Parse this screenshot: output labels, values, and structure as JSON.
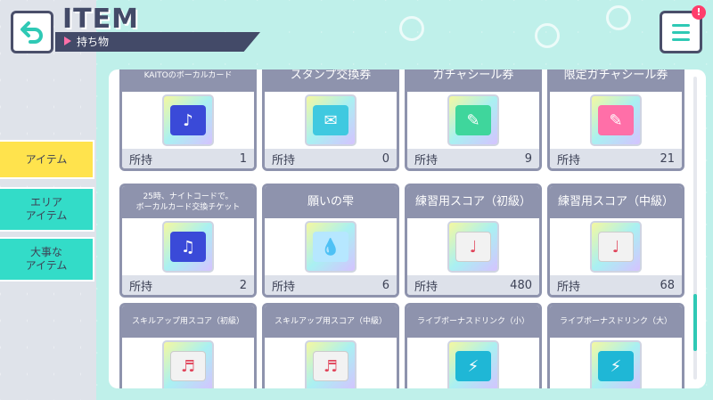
{
  "header": {
    "title": "ITEM",
    "subtitle": "持ち物",
    "notification_badge": "!"
  },
  "sidebar": {
    "tabs": [
      {
        "label": "アイテム",
        "active": true
      },
      {
        "label": "エリア\nアイテム",
        "active": false
      },
      {
        "label": "大事な\nアイテム",
        "active": false
      }
    ]
  },
  "items": [
    {
      "name": "KAITOのボーカルカード",
      "owned_label": "所持",
      "count": "1",
      "icon": "music-card-icon"
    },
    {
      "name": "スタンプ交換券",
      "owned_label": "所持",
      "count": "0",
      "icon": "stamp-ticket-icon"
    },
    {
      "name": "ガチャシール券",
      "owned_label": "所持",
      "count": "9",
      "icon": "gacha-seal-ticket-icon"
    },
    {
      "name": "限定ガチャシール券",
      "owned_label": "所持",
      "count": "21",
      "icon": "limited-gacha-seal-ticket-icon"
    },
    {
      "name": "25時、ナイトコードで。\nボーカルカード交換チケット",
      "owned_label": "所持",
      "count": "2",
      "icon": "vocal-card-exchange-ticket-icon"
    },
    {
      "name": "願いの雫",
      "owned_label": "所持",
      "count": "6",
      "icon": "wish-drop-icon"
    },
    {
      "name": "練習用スコア（初級）",
      "owned_label": "所持",
      "count": "480",
      "icon": "practice-score-beginner-icon"
    },
    {
      "name": "練習用スコア（中級）",
      "owned_label": "所持",
      "count": "68",
      "icon": "practice-score-intermediate-icon"
    },
    {
      "name": "スキルアップ用スコア（初級）",
      "owned_label": "",
      "count": "",
      "icon": "skill-score-beginner-icon"
    },
    {
      "name": "スキルアップ用スコア（中級）",
      "owned_label": "",
      "count": "",
      "icon": "skill-score-intermediate-icon"
    },
    {
      "name": "ライブボーナスドリンク（小）",
      "owned_label": "",
      "count": "",
      "icon": "live-bonus-drink-small-icon"
    },
    {
      "name": "ライブボーナスドリンク（大）",
      "owned_label": "",
      "count": "",
      "icon": "live-bonus-drink-large-icon"
    }
  ],
  "colors": {
    "accent_teal": "#2fc9b5",
    "active_tab": "#ffe34d",
    "card_header": "#8e93ad"
  }
}
